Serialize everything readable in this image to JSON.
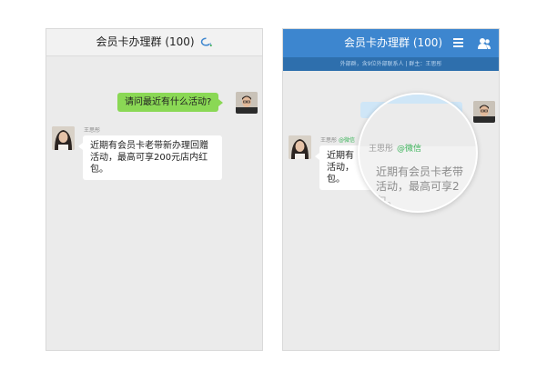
{
  "left_phone": {
    "header_title": "会员卡办理群 (100)",
    "outgoing_message": "请问最近有什么活动?",
    "sender_name": "王思彤",
    "incoming_message_line1": "近期有会员卡老带新办理回赠",
    "incoming_message_line2": "活动，最高可享200元店内红",
    "incoming_message_line3": "包。"
  },
  "right_phone": {
    "header_title": "会员卡办理群 (100)",
    "subbar_text": "外部群，含9位外部联系人 | 群主：王思彤",
    "sender_name": "王思彤",
    "sender_tag": "@微信",
    "incoming_line1": "近期有",
    "incoming_line2": "活动，",
    "incoming_line3": "包。",
    "lens_sender_name": "王思彤",
    "lens_sender_tag": "@微信",
    "lens_line1": "近期有会员卡老带",
    "lens_line2": "活动，最高可享2",
    "lens_line3": "包。"
  },
  "colors": {
    "header_blue": "#3d86cf",
    "outgoing_bubble": "#8ad855",
    "wechat_tag": "#3cb35a"
  }
}
